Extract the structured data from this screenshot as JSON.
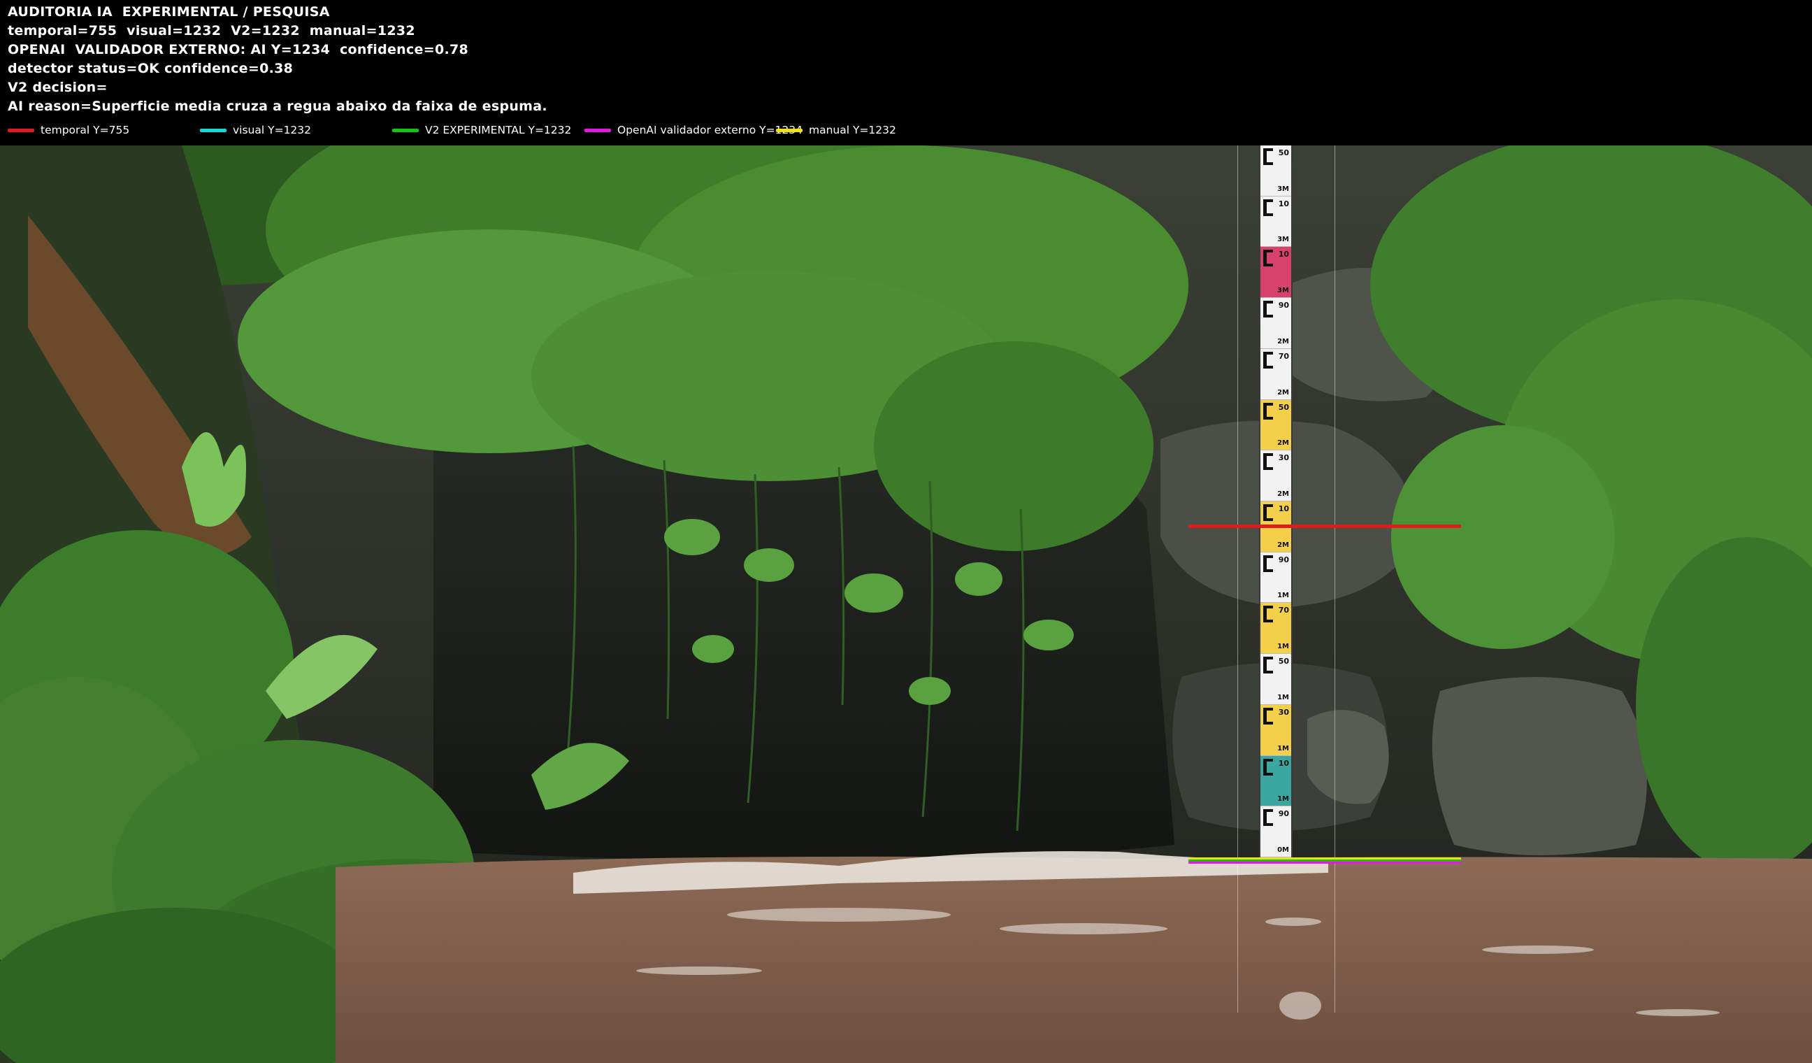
{
  "header": {
    "lines": [
      "AUDITORIA IA  EXPERIMENTAL / PESQUISA",
      "temporal=755  visual=1232  V2=1232  manual=1232",
      "OPENAI  VALIDADOR EXTERNO: AI Y=1234  confidence=0.78",
      "detector status=OK confidence=0.38",
      "V2 decision=",
      "AI reason=Superficie media cruza a regua abaixo da faixa de espuma."
    ]
  },
  "legend": [
    {
      "label": "temporal Y=755",
      "color": "#e01b1b"
    },
    {
      "label": "visual Y=1232",
      "color": "#19d8d8"
    },
    {
      "label": "V2 EXPERIMENTAL Y=1232",
      "color": "#17c317"
    },
    {
      "label": "OpenAI validador externo Y=1234",
      "color": "#e01be0"
    },
    {
      "label": "manual Y=1232",
      "color": "#f0e21a"
    }
  ],
  "gauge": {
    "marks": [
      {
        "code": "50",
        "unit": "3M"
      },
      {
        "code": "10",
        "unit": "3M"
      },
      {
        "code": "10",
        "unit": "3M"
      },
      {
        "code": "90",
        "unit": "2M"
      },
      {
        "code": "70",
        "unit": "2M"
      },
      {
        "code": "50",
        "unit": "2M"
      },
      {
        "code": "30",
        "unit": "2M"
      },
      {
        "code": "10",
        "unit": "2M"
      },
      {
        "code": "90",
        "unit": "1M"
      },
      {
        "code": "70",
        "unit": "1M"
      },
      {
        "code": "50",
        "unit": "1M"
      },
      {
        "code": "30",
        "unit": "1M"
      },
      {
        "code": "10",
        "unit": "1M"
      },
      {
        "code": "90",
        "unit": "0M"
      }
    ]
  },
  "colors": {
    "temporal": "#e01b1b",
    "visual": "#19d8d8",
    "v2": "#17c317",
    "openai": "#e01be0",
    "manual": "#f0e21a"
  }
}
